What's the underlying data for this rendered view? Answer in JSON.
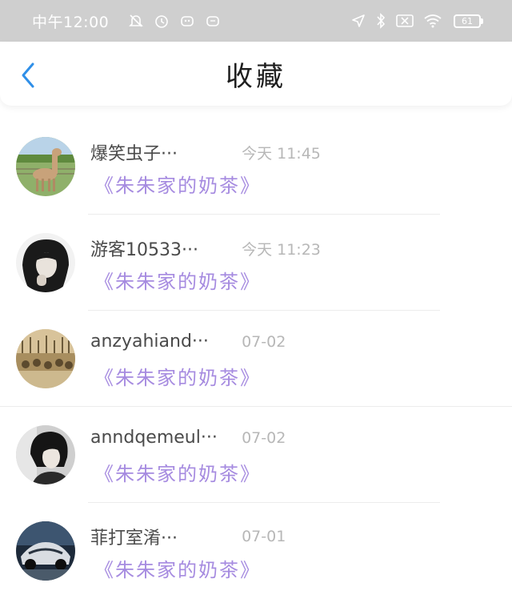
{
  "status_bar": {
    "time": "中午12:00",
    "battery": "61"
  },
  "header": {
    "title": "收藏"
  },
  "items": [
    {
      "name": "爆笑虫子···",
      "time": "今天 11:45",
      "source": "《朱朱家的奶茶》"
    },
    {
      "name": "游客10533···",
      "time": "今天 11:23",
      "source": "《朱朱家的奶茶》"
    },
    {
      "name": "anzyahiand···",
      "time": "07-02",
      "source": "《朱朱家的奶茶》"
    },
    {
      "name": "anndqemeul···",
      "time": "07-02",
      "source": "《朱朱家的奶茶》"
    },
    {
      "name": "菲打室淆···",
      "time": "07-01",
      "source": "《朱朱家的奶茶》"
    }
  ],
  "colors": {
    "accent": "#2f8fe8",
    "source_text": "#a68be0",
    "status_bar_bg": "#cfcfcf"
  }
}
